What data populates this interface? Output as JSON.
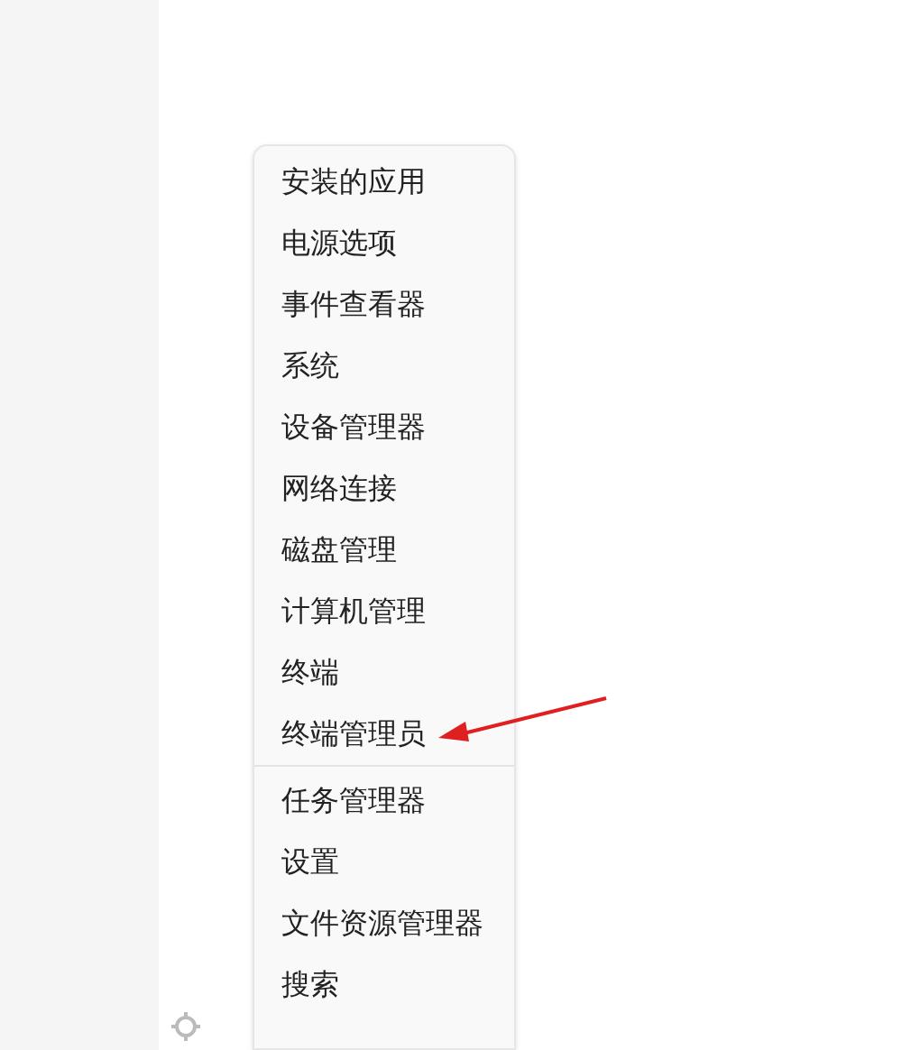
{
  "menu": {
    "sections": [
      {
        "items": [
          {
            "label": "安装的应用"
          },
          {
            "label": "电源选项"
          },
          {
            "label": "事件查看器"
          },
          {
            "label": "系统"
          },
          {
            "label": "设备管理器"
          },
          {
            "label": "网络连接"
          },
          {
            "label": "磁盘管理"
          },
          {
            "label": "计算机管理"
          },
          {
            "label": "终端"
          },
          {
            "label": "终端管理员"
          }
        ]
      },
      {
        "items": [
          {
            "label": "任务管理器"
          },
          {
            "label": "设置"
          },
          {
            "label": "文件资源管理器"
          },
          {
            "label": "搜索"
          }
        ]
      }
    ]
  }
}
